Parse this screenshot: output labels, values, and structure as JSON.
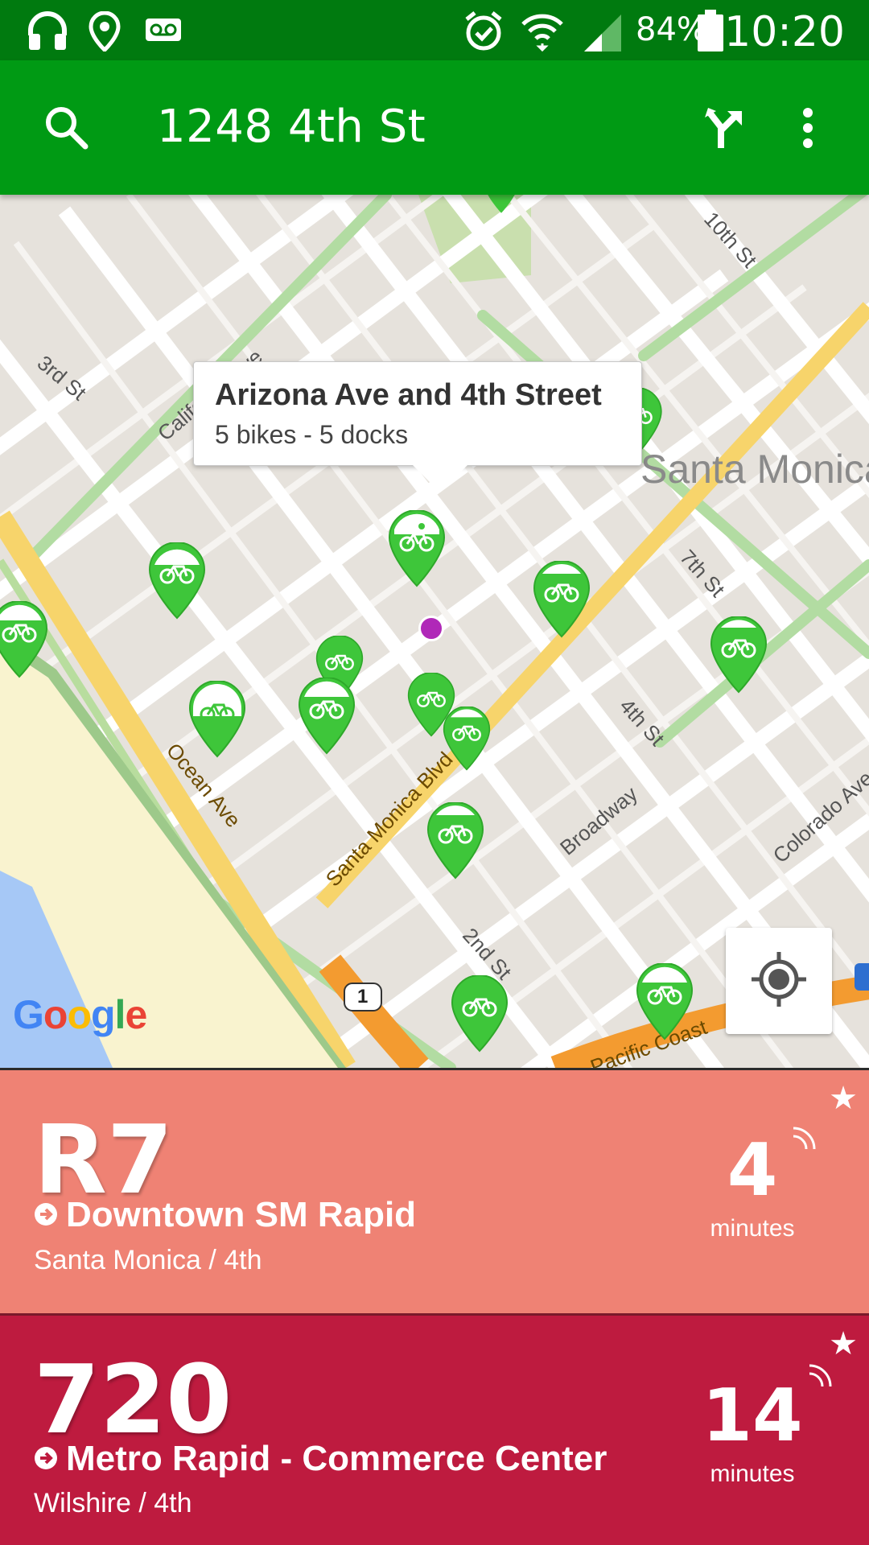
{
  "status_bar": {
    "battery": "84%",
    "time": "10:20",
    "icons": [
      "headphones-icon",
      "location-icon",
      "voicemail-icon",
      "alarm-icon",
      "wifi-icon",
      "signal-icon",
      "battery-icon"
    ]
  },
  "app_bar": {
    "title": "1248 4th St",
    "icons": [
      "search-icon",
      "directions-icon",
      "overflow-menu-icon"
    ]
  },
  "map": {
    "callout": {
      "title": "Arizona Ave and 4th Street",
      "subtitle": "5 bikes - 5 docks"
    },
    "labels": {
      "california": "California Ave",
      "third": "3rd St",
      "santa_monica": "Santa Monica",
      "seventh": "7th St",
      "tenth": "10th St",
      "ocean": "Ocean Ave",
      "smblvd": "Santa Monica Blvd",
      "broadway": "Broadway",
      "fourth": "4th St",
      "second": "2nd St",
      "colorado": "Colorado Ave",
      "pacific": "Pacific Coast",
      "route_one": "1"
    },
    "attribution": "Google",
    "marker_color": "#3ec63a",
    "location_dot_color": "#b028b8"
  },
  "arrivals": [
    {
      "route": "R7",
      "destination": "Downtown SM Rapid",
      "stop": "Santa Monica / 4th",
      "eta": "4",
      "eta_unit": "minutes",
      "color": "#ef8274"
    },
    {
      "route": "720",
      "destination": "Metro Rapid - Commerce Center",
      "stop": "Wilshire / 4th",
      "eta": "14",
      "eta_unit": "minutes",
      "color": "#be1b3f"
    }
  ]
}
